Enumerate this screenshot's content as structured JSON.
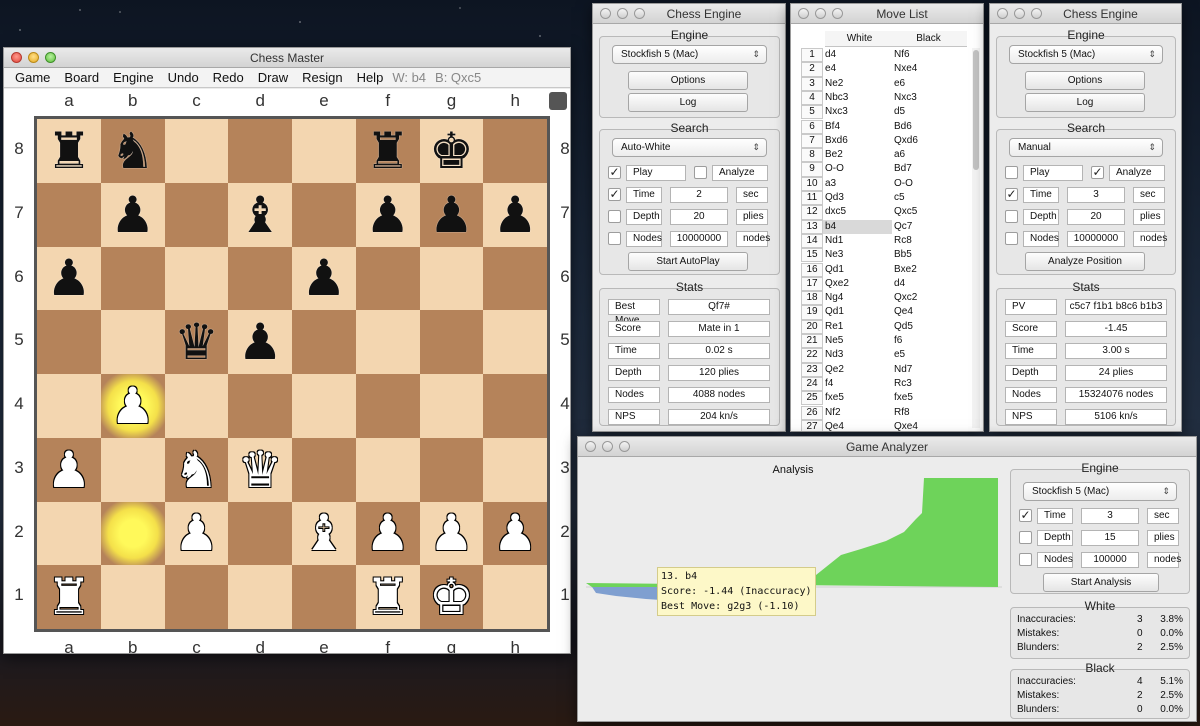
{
  "chess_master": {
    "title": "Chess Master",
    "menu": [
      "Game",
      "Board",
      "Engine",
      "Undo",
      "Redo",
      "Draw",
      "Resign",
      "Help"
    ],
    "status_white": "W: b4",
    "status_black": "B: Qxc5",
    "files": [
      "a",
      "b",
      "c",
      "d",
      "e",
      "f",
      "g",
      "h"
    ],
    "ranks": [
      "8",
      "7",
      "6",
      "5",
      "4",
      "3",
      "2",
      "1"
    ],
    "board": [
      [
        "r",
        "n",
        "",
        "",
        "",
        "r",
        "k",
        ""
      ],
      [
        "",
        "p",
        "",
        "b",
        "",
        "p",
        "p",
        "p"
      ],
      [
        "p",
        "",
        "",
        "",
        "p",
        "",
        "",
        ""
      ],
      [
        "",
        "",
        "q",
        "p",
        "",
        "",
        "",
        ""
      ],
      [
        "",
        "P",
        "",
        "",
        "",
        "",
        "",
        ""
      ],
      [
        "P",
        "",
        "N",
        "Q",
        "",
        "",
        "",
        ""
      ],
      [
        "",
        "",
        "P",
        "",
        "B",
        "P",
        "P",
        "P"
      ],
      [
        "R",
        "",
        "",
        "",
        "",
        "R",
        "K",
        ""
      ]
    ],
    "highlight_squares": [
      "b4",
      "b2"
    ]
  },
  "engine_left": {
    "title": "Chess Engine",
    "engine_label": "Engine",
    "engine_select": "Stockfish 5 (Mac)",
    "options_button": "Options",
    "log_button": "Log",
    "search_label": "Search",
    "mode_select": "Auto-White",
    "play_label": "Play",
    "play_checked": "✓",
    "analyze_label": "Analyze",
    "time_label": "Time",
    "time_checked": "✓",
    "time_value": "2",
    "time_unit": "sec",
    "depth_label": "Depth",
    "depth_value": "20",
    "depth_unit": "plies",
    "nodes_label": "Nodes",
    "nodes_value": "10000000",
    "nodes_unit": "nodes",
    "action_button": "Start AutoPlay",
    "stats_label": "Stats",
    "stats": [
      {
        "label": "Best Move",
        "value": "Qf7#"
      },
      {
        "label": "Score",
        "value": "Mate in 1"
      },
      {
        "label": "Time",
        "value": "0.02 s"
      },
      {
        "label": "Depth",
        "value": "120 plies"
      },
      {
        "label": "Nodes",
        "value": "4088 nodes"
      },
      {
        "label": "NPS",
        "value": "204 kn/s"
      }
    ]
  },
  "move_list": {
    "title": "Move List",
    "col_white": "White",
    "col_black": "Black",
    "moves": [
      [
        "1",
        "d4",
        "Nf6"
      ],
      [
        "2",
        "e4",
        "Nxe4"
      ],
      [
        "3",
        "Ne2",
        "e6"
      ],
      [
        "4",
        "Nbc3",
        "Nxc3"
      ],
      [
        "5",
        "Nxc3",
        "d5"
      ],
      [
        "6",
        "Bf4",
        "Bd6"
      ],
      [
        "7",
        "Bxd6",
        "Qxd6"
      ],
      [
        "8",
        "Be2",
        "a6"
      ],
      [
        "9",
        "O-O",
        "Bd7"
      ],
      [
        "10",
        "a3",
        "O-O"
      ],
      [
        "11",
        "Qd3",
        "c5"
      ],
      [
        "12",
        "dxc5",
        "Qxc5"
      ],
      [
        "13",
        "b4",
        "Qc7"
      ],
      [
        "14",
        "Nd1",
        "Rc8"
      ],
      [
        "15",
        "Ne3",
        "Bb5"
      ],
      [
        "16",
        "Qd1",
        "Bxe2"
      ],
      [
        "17",
        "Qxe2",
        "d4"
      ],
      [
        "18",
        "Ng4",
        "Qxc2"
      ],
      [
        "19",
        "Qd1",
        "Qe4"
      ],
      [
        "20",
        "Re1",
        "Qd5"
      ],
      [
        "21",
        "Ne5",
        "f6"
      ],
      [
        "22",
        "Nd3",
        "e5"
      ],
      [
        "23",
        "Qe2",
        "Nd7"
      ],
      [
        "24",
        "f4",
        "Rc3"
      ],
      [
        "25",
        "fxe5",
        "fxe5"
      ],
      [
        "26",
        "Nf2",
        "Rf8"
      ],
      [
        "27",
        "Qe4",
        "Qxe4"
      ]
    ],
    "selected_index": 12
  },
  "engine_right": {
    "title": "Chess Engine",
    "engine_label": "Engine",
    "engine_select": "Stockfish 5 (Mac)",
    "options_button": "Options",
    "log_button": "Log",
    "search_label": "Search",
    "mode_select": "Manual",
    "play_label": "Play",
    "analyze_label": "Analyze",
    "analyze_checked": "✓",
    "time_label": "Time",
    "time_checked": "✓",
    "time_value": "3",
    "time_unit": "sec",
    "depth_label": "Depth",
    "depth_value": "20",
    "depth_unit": "plies",
    "nodes_label": "Nodes",
    "nodes_value": "10000000",
    "nodes_unit": "nodes",
    "action_button": "Analyze Position",
    "stats_label": "Stats",
    "stats": [
      {
        "label": "PV",
        "value": "c5c7 f1b1 b8c6 b1b3"
      },
      {
        "label": "Score",
        "value": "-1.45"
      },
      {
        "label": "Time",
        "value": "3.00 s"
      },
      {
        "label": "Depth",
        "value": "24 plies"
      },
      {
        "label": "Nodes",
        "value": "15324076 nodes"
      },
      {
        "label": "NPS",
        "value": "5106 kn/s"
      }
    ]
  },
  "analyzer": {
    "title": "Game Analyzer",
    "analysis_label": "Analysis",
    "tooltip_line1": "13. b4",
    "tooltip_line2": "Score: -1.44 (Inaccuracy)",
    "tooltip_line3": "Best Move: g2g3 (-1.10)",
    "engine_label": "Engine",
    "engine_select": "Stockfish 5 (Mac)",
    "time_label": "Time",
    "time_checked": "✓",
    "time_value": "3",
    "time_unit": "sec",
    "depth_label": "Depth",
    "depth_value": "15",
    "depth_unit": "plies",
    "nodes_label": "Nodes",
    "nodes_value": "100000",
    "nodes_unit": "nodes",
    "start_button": "Start Analysis",
    "white_label": "White",
    "black_label": "Black",
    "white_summary": [
      {
        "label": "Inaccuracies:",
        "count": "3",
        "pct": "3.8%"
      },
      {
        "label": "Mistakes:",
        "count": "0",
        "pct": "0.0%"
      },
      {
        "label": "Blunders:",
        "count": "2",
        "pct": "2.5%"
      }
    ],
    "black_summary": [
      {
        "label": "Inaccuracies:",
        "count": "4",
        "pct": "5.1%"
      },
      {
        "label": "Mistakes:",
        "count": "2",
        "pct": "2.5%"
      },
      {
        "label": "Blunders:",
        "count": "0",
        "pct": "0.0%"
      }
    ],
    "colors": {
      "white_adv": "#6ed35a",
      "black_adv": "#7f9fd0"
    }
  }
}
